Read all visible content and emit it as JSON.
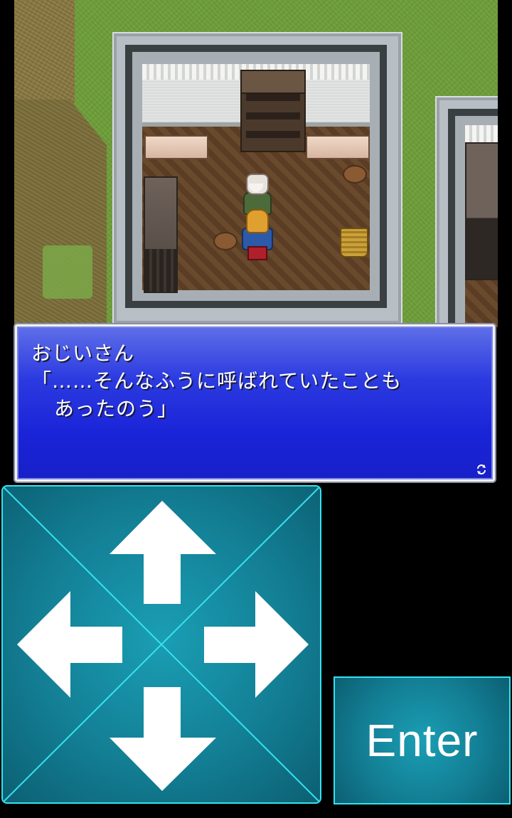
{
  "dialog": {
    "speaker": "おじいさん",
    "line1": "「……そんなふうに呼ばれていたことも",
    "line2": "あったのう」",
    "next_indicator_icon": "refresh-arrows-icon",
    "colors": {
      "background_top": "#5f6fe8",
      "background_bottom": "#1820c8",
      "border": "#f2f2f2",
      "text": "#ffffff"
    }
  },
  "controls": {
    "dpad": {
      "up_icon": "arrow-up-icon",
      "down_icon": "arrow-down-icon",
      "left_icon": "arrow-left-icon",
      "right_icon": "arrow-right-icon",
      "border_color": "#35e2f0",
      "fill_color": "#137f95",
      "arrow_color": "#ffffff"
    },
    "enter": {
      "label": "Enter",
      "border_color": "#35e2f0"
    }
  },
  "map": {
    "scene": "house-interior",
    "characters": [
      "old-man",
      "hero"
    ]
  }
}
